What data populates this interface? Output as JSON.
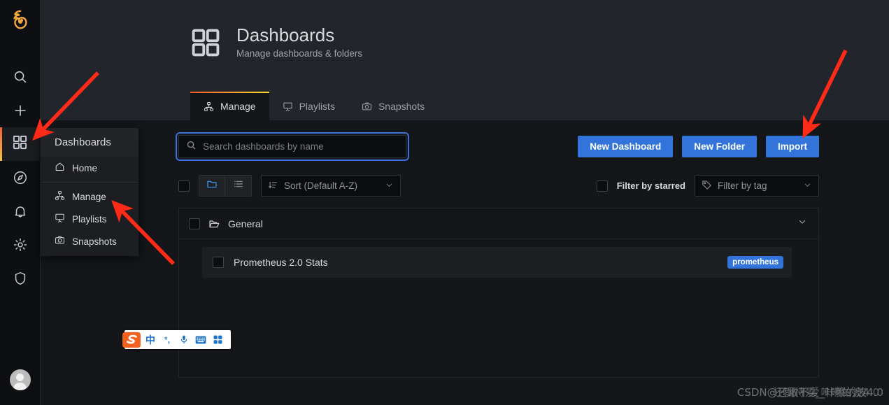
{
  "nav": {
    "brand_icon": "grafana-logo-icon",
    "items": [
      {
        "icon": "search-icon",
        "name": "search"
      },
      {
        "icon": "plus-icon",
        "name": "create"
      },
      {
        "icon": "dashboards-grid-icon",
        "name": "dashboards",
        "active": true
      },
      {
        "icon": "compass-explore-icon",
        "name": "explore"
      },
      {
        "icon": "bell-alerting-icon",
        "name": "alerting"
      },
      {
        "icon": "gear-configuration-icon",
        "name": "configuration"
      },
      {
        "icon": "shield-admin-icon",
        "name": "server-admin"
      }
    ],
    "avatar_label": "user-avatar"
  },
  "flyout": {
    "header": "Dashboards",
    "items": [
      {
        "label": "Home",
        "icon": "home-icon"
      },
      {
        "label": "Manage",
        "icon": "sitemap-icon"
      },
      {
        "label": "Playlists",
        "icon": "presentation-icon"
      },
      {
        "label": "Snapshots",
        "icon": "camera-icon"
      }
    ]
  },
  "header": {
    "icon": "dashboards-grid-icon",
    "title": "Dashboards",
    "subtitle": "Manage dashboards & folders"
  },
  "tabs": [
    {
      "label": "Manage",
      "icon": "sitemap-icon",
      "active": true
    },
    {
      "label": "Playlists",
      "icon": "presentation-icon",
      "active": false
    },
    {
      "label": "Snapshots",
      "icon": "camera-icon",
      "active": false
    }
  ],
  "search": {
    "placeholder": "Search dashboards by name",
    "value": "",
    "icon": "search-icon"
  },
  "actions": {
    "new_dashboard": "New Dashboard",
    "new_folder": "New Folder",
    "import": "Import"
  },
  "filters": {
    "select_all_label": "select-all",
    "view_folder_icon": "folder-icon",
    "view_list_icon": "list-icon",
    "sort": {
      "label": "Sort (Default A-Z)",
      "icon": "sort-amount-down-icon",
      "chevron": "chevron-down-icon"
    },
    "starred_label": "Filter by starred",
    "tag": {
      "label": "Filter by tag",
      "icon": "tag-icon",
      "chevron": "chevron-down-icon"
    }
  },
  "list": {
    "folder": {
      "name": "General",
      "icon": "folder-open-icon",
      "chevron": "chevron-down-icon"
    },
    "dashboards": [
      {
        "name": "Prometheus 2.0 Stats",
        "tag": "prometheus"
      }
    ]
  },
  "ime": {
    "logo": "sogou-logo-icon",
    "mode": "中",
    "punctuation": "°,",
    "mic_icon": "microphone-icon",
    "keyboard_icon": "keyboard-icon",
    "apps_icon": "apps-grid-icon"
  },
  "watermark": {
    "text_a": "CSDN@还敢不爱_咔嚓的波4.0",
    "text_b": "还期待爱_咔嚓的波4.0"
  },
  "colors": {
    "accent_blue": "#3274d9",
    "tab_gradient_start": "#f05a28",
    "tab_gradient_end": "#fadc2e",
    "focus_outline": "#3871dc",
    "annotation_red": "#ff2a18",
    "panel_bg": "#141619",
    "header_bg": "#22252b",
    "rail_bg": "#0e0f12"
  }
}
